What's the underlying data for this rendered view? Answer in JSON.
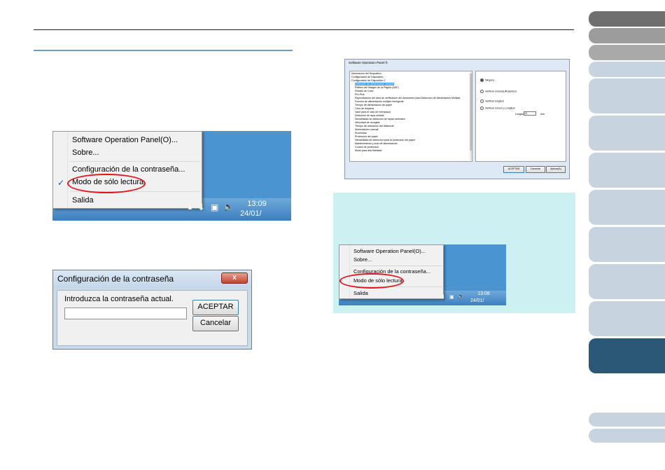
{
  "tray_menu": {
    "items": [
      {
        "label": "Software Operation Panel(O)...",
        "checked": false
      },
      {
        "label": "Sobre...",
        "checked": false
      },
      {
        "label": "Configuración de la contraseña...",
        "checked": false
      },
      {
        "label": "Modo de sólo lectura",
        "checked": true
      },
      {
        "label": "Salida",
        "checked": false
      }
    ],
    "check_mark": "✓",
    "clock_time": "13:09",
    "clock_date": "24/01/"
  },
  "password_dialog": {
    "title": "Configuración de la contraseña",
    "close_label": "x",
    "prompt": "Introduzca la contraseña actual.",
    "password_value": "",
    "ok_label": "ACEPTAR",
    "cancel_label": "Cancelar"
  },
  "operation_panel": {
    "title": "Software Operation Panel fi-",
    "tree": [
      "Información del Dispositivo",
      "Configuración de Dispositivo",
      "Configuración de Dispositivo 2",
      "Detección de alimentación múltiple",
      "Relleno del Margen de la Página (ADF)",
      "Filtrado de Color",
      "Pre-Pick",
      "Especificación del área de verificación del documento para Detección de Alimentación Múltiple",
      "Función de alimentación múltiple inteligente",
      "Tiempo de alimentación de papel",
      "Ciclo de limpieza",
      "Valor para el ciclo de reemplazo",
      "Detección de raya vertical",
      "Sensibilidad de detección de rayas verticales",
      "Velocidad de recogida",
      "Tiempo de activación del desborde",
      "Alimentación manual",
      "Encendido",
      "Protección del papel",
      "Sensibilidad de detección para la protección del papel",
      "Mantenimiento y ciclo de alimentación",
      "Control de protección",
      "Modo para alta fidelidad"
    ],
    "options": [
      "Ninguno",
      "Verificar Grosor(Ultrasónico)",
      "Verificar longitud",
      "Verificar Grosor y Longitud"
    ],
    "length_label": "Longitud",
    "length_value": "10",
    "length_unit": "mm",
    "ok_label": "ACEPTAR",
    "cancel_label": "Cancelar",
    "apply_label": "Aplicar(A)"
  },
  "hint_menu": {
    "items": [
      {
        "label": "Software Operation Panel(O)..."
      },
      {
        "label": "Sobre..."
      },
      {
        "label": "Configuración de la contraseña..."
      },
      {
        "label": "Modo de sólo lectura"
      },
      {
        "label": "Salida"
      }
    ],
    "clock_time": "13:08",
    "clock_date": "24/01/"
  },
  "colors": {
    "rule_accent": "#6e9ac4",
    "desktop": "#4a95d1",
    "highlight_circle": "#e0141c",
    "hint_background": "#cdf0f3",
    "tab_active": "#2c5878",
    "tab_inactive": "#c7d3df"
  }
}
